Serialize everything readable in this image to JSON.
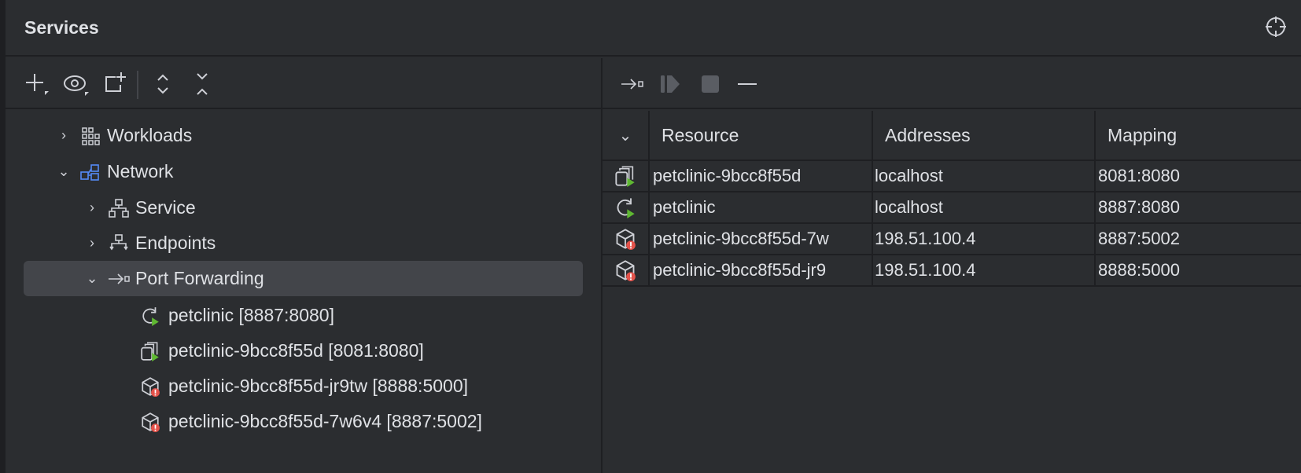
{
  "panel": {
    "title": "Services"
  },
  "tree": [
    {
      "label": "Workloads",
      "icon": "workloads-icon",
      "expanded": false
    },
    {
      "label": "Network",
      "icon": "network-icon",
      "expanded": true
    },
    {
      "label": "Service",
      "icon": "service-icon",
      "expanded": false
    },
    {
      "label": "Endpoints",
      "icon": "endpoints-icon",
      "expanded": false
    },
    {
      "label": "Port Forwarding",
      "icon": "port-forward-icon",
      "expanded": true,
      "selected": true
    },
    {
      "label": "petclinic [8887:8080]",
      "icon": "service-running-icon"
    },
    {
      "label": "petclinic-9bcc8f55d [8081:8080]",
      "icon": "replicaset-running-icon"
    },
    {
      "label": "petclinic-9bcc8f55d-jr9tw [8888:5000]",
      "icon": "pod-error-icon"
    },
    {
      "label": "petclinic-9bcc8f55d-7w6v4 [8887:5002]",
      "icon": "pod-error-icon"
    }
  ],
  "table": {
    "headers": [
      "Resource",
      "Addresses",
      "Mapping"
    ],
    "rows": [
      {
        "icon": "replicaset-running-icon",
        "resource": "petclinic-9bcc8f55d",
        "address": "localhost",
        "mapping": "8081:8080"
      },
      {
        "icon": "service-running-icon",
        "resource": "petclinic",
        "address": "localhost",
        "mapping": "8887:8080"
      },
      {
        "icon": "pod-error-icon",
        "resource": "petclinic-9bcc8f55d-7w",
        "address": "198.51.100.4",
        "mapping": "8887:5002"
      },
      {
        "icon": "pod-error-icon",
        "resource": "petclinic-9bcc8f55d-jr9",
        "address": "198.51.100.4",
        "mapping": "8888:5000"
      }
    ]
  },
  "colors": {
    "bg": "#2b2d30",
    "border": "#1e1f22",
    "selected": "#43454a",
    "green": "#5fb832",
    "red": "#e5534b",
    "network": "#548af7"
  }
}
